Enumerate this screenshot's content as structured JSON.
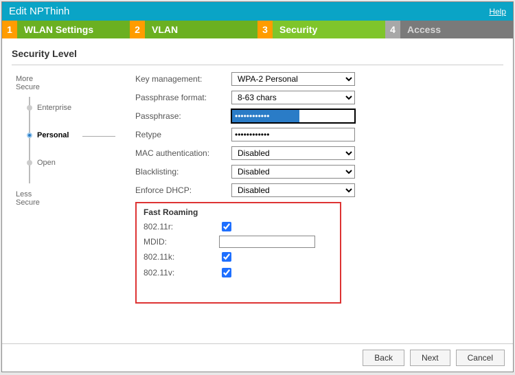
{
  "window": {
    "title": "Edit NPThinh",
    "help": "Help"
  },
  "tabs": [
    {
      "num": "1",
      "label": "WLAN Settings",
      "state": "done"
    },
    {
      "num": "2",
      "label": "VLAN",
      "state": "done"
    },
    {
      "num": "3",
      "label": "Security",
      "state": "current"
    },
    {
      "num": "4",
      "label": "Access",
      "state": "inactive"
    }
  ],
  "section_title": "Security Level",
  "security_levels": {
    "more_label": "More\nSecure",
    "less_label": "Less\nSecure",
    "enterprise": "Enterprise",
    "personal": "Personal",
    "open": "Open",
    "selected": "personal"
  },
  "form": {
    "key_management": {
      "label": "Key management:",
      "value": "WPA-2 Personal"
    },
    "passphrase_format": {
      "label": "Passphrase format:",
      "value": "8-63 chars"
    },
    "passphrase": {
      "label": "Passphrase:",
      "value": "••••••••••••"
    },
    "retype": {
      "label": "Retype",
      "value": "••••••••••••"
    },
    "mac_auth": {
      "label": "MAC authentication:",
      "value": "Disabled"
    },
    "blacklisting": {
      "label": "Blacklisting:",
      "value": "Disabled"
    },
    "enforce_dhcp": {
      "label": "Enforce DHCP:",
      "value": "Disabled"
    }
  },
  "fast_roaming": {
    "title": "Fast Roaming",
    "r_label": "802.11r:",
    "r_checked": true,
    "mdid_label": "MDID:",
    "mdid_value": "",
    "k_label": "802.11k:",
    "k_checked": true,
    "v_label": "802.11v:",
    "v_checked": true
  },
  "footer": {
    "back": "Back",
    "next": "Next",
    "cancel": "Cancel"
  }
}
